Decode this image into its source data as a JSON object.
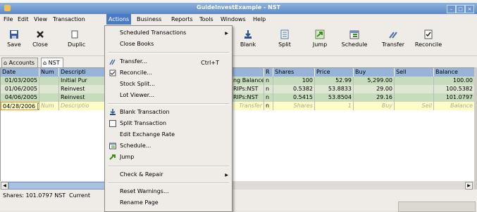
{
  "window": {
    "title": "GuideInvestExample - NST"
  },
  "menubar": {
    "file": "File",
    "edit": "Edit",
    "view": "View",
    "transaction": "Transaction",
    "actions": "Actions",
    "business": "Business",
    "reports": "Reports",
    "tools": "Tools",
    "windows": "Windows",
    "help": "Help"
  },
  "toolbar": {
    "save": "Save",
    "close": "Close",
    "duplicate": "Duplic",
    "blank": "Blank",
    "split": "Split",
    "jump": "Jump",
    "schedule": "Schedule",
    "transfer": "Transfer",
    "reconcile": "Reconcile"
  },
  "tabs": {
    "accounts": "Accounts",
    "nst": "NST"
  },
  "register": {
    "columns": [
      "Date",
      "Num",
      "Descripti",
      "",
      "R",
      "Shares",
      "Price",
      "Buy",
      "Sell",
      "Balance"
    ],
    "rows": [
      {
        "date": "01/03/2005",
        "num": "",
        "desc": "Initial Pur",
        "transfer": "ng Balance",
        "r": "n",
        "shares": "100",
        "price": "52.99",
        "buy": "5,299.00",
        "sell": "",
        "balance": "100.00"
      },
      {
        "date": "01/06/2005",
        "num": "",
        "desc": "Reinvest",
        "transfer": "RIPs:NST",
        "r": "n",
        "shares": "0.5382",
        "price": "53.8833",
        "buy": "29.00",
        "sell": "",
        "balance": "100.5382"
      },
      {
        "date": "04/06/2005",
        "num": "",
        "desc": "Reinvest",
        "transfer": "RIPs:NST",
        "r": "n",
        "shares": "0.5415",
        "price": "53.8504",
        "buy": "29.16",
        "sell": "",
        "balance": "101.0797"
      }
    ],
    "blank": {
      "date": "04/28/2006",
      "num": "Num",
      "desc": "Descriptio",
      "transfer": "Transfer",
      "r": "n",
      "shares": "Shares",
      "price": "1",
      "buy": "Buy",
      "sell": "Sell",
      "balance": "Balance"
    }
  },
  "status": {
    "shares": "Shares: 101.0797 NST",
    "current": "Current"
  },
  "actions_menu": {
    "scheduled": "Scheduled Transactions",
    "close_books": "Close Books",
    "transfer": "Transfer...",
    "transfer_accel": "Ctrl+T",
    "reconcile": "Reconcile...",
    "stock_split": "Stock Split...",
    "lot_viewer": "Lot Viewer...",
    "blank": "Blank Transaction",
    "split": "Split Transaction",
    "exchange": "Edit Exchange Rate",
    "schedule": "Schedule...",
    "jump": "Jump",
    "check_repair": "Check & Repair",
    "reset_warnings": "Reset Warnings...",
    "rename_page": "Rename Page"
  }
}
